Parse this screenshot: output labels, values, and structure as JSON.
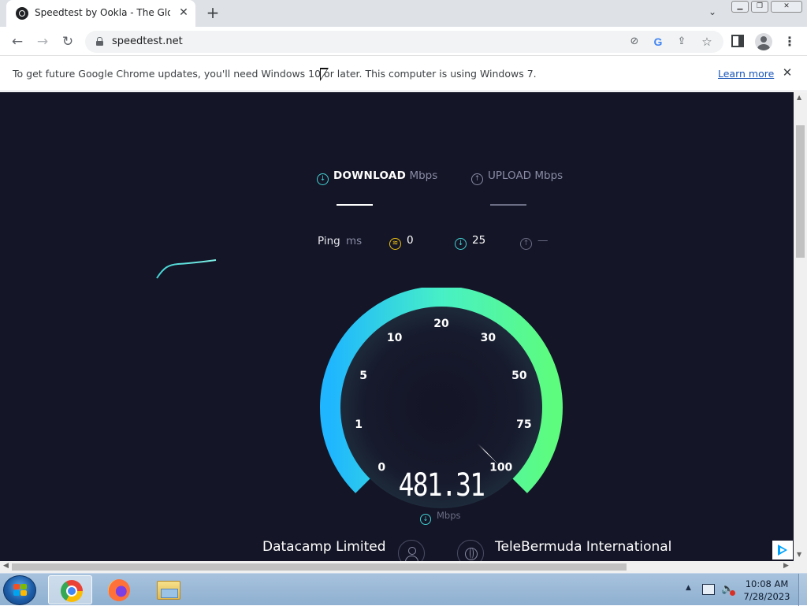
{
  "browser": {
    "tab_title": "Speedtest by Ookla - The Global",
    "tab_close": "✕",
    "new_tab": "+",
    "tab_search": "⌄",
    "window_controls": {
      "minimize": "▁",
      "maximize": "❐",
      "close": "✕"
    },
    "nav": {
      "back": "←",
      "forward": "→",
      "reload": "↻"
    },
    "url": "speedtest.net",
    "menu": "⋮",
    "omnibox_icons": [
      "blocked-icon",
      "google-icon",
      "share-icon",
      "star-icon"
    ],
    "google_glyph": "G",
    "share_glyph": "⇪",
    "star_glyph": "☆",
    "blocked_glyph": "⊘"
  },
  "infobar": {
    "message": "To get future Google Chrome updates, you'll need Windows 10 or later. This computer is using Windows 7.",
    "learn_more": "Learn more",
    "close": "✕"
  },
  "speedtest": {
    "download_label": "DOWNLOAD",
    "download_unit": "Mbps",
    "upload_label": "UPLOAD",
    "upload_unit": "Mbps",
    "ping_label": "Ping",
    "ping_unit": "ms",
    "ping_idle": "0",
    "ping_download": "25",
    "ping_upload": "—",
    "gauge_ticks": [
      "0",
      "1",
      "5",
      "10",
      "20",
      "30",
      "50",
      "75",
      "100"
    ],
    "speed_value": "481.31",
    "speed_unit": "Mbps",
    "isp_name": "Datacamp Limited",
    "server_name": "TeleBermuda International",
    "gauge_fill_fraction": 1.0,
    "colors": {
      "background": "#141526",
      "gauge_start": "#1fb6ff",
      "gauge_end": "#5dfc7e",
      "accent": "#43d3d5"
    }
  },
  "taskbar": {
    "apps": [
      "chrome",
      "firefox",
      "file-explorer"
    ],
    "time": "10:08 AM",
    "date": "7/28/2023",
    "tray_arrow": "▲",
    "volume_glyph": "🔈"
  }
}
